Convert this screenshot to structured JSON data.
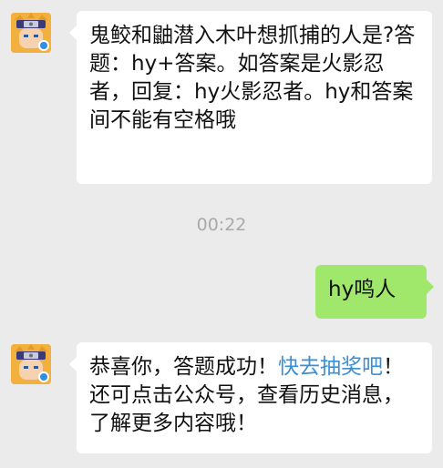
{
  "messages": [
    {
      "sender": "incoming",
      "text": "鬼鲛和鼬潜入木叶想抓捕的人是?答题：hy+答案。如答案是火影忍者，回复：hy火影忍者。hy和答案间不能有空格哦"
    },
    {
      "timestamp": "00:22"
    },
    {
      "sender": "outgoing",
      "text": "hy鸣人"
    },
    {
      "sender": "incoming",
      "text_before": "恭喜你，答题成功！",
      "link": "快去抽奖吧",
      "text_after": "！还可点击公众号，查看历史消息，了解更多内容哦！"
    }
  ],
  "colors": {
    "background": "#ebebeb",
    "incoming_bubble": "#ffffff",
    "outgoing_bubble": "#9fe86b",
    "link": "#3b8fd6",
    "timestamp": "#a9a9a9"
  },
  "icons": {
    "avatar": "naruto-avatar-icon",
    "avatar_badge": "game-logo-icon"
  }
}
